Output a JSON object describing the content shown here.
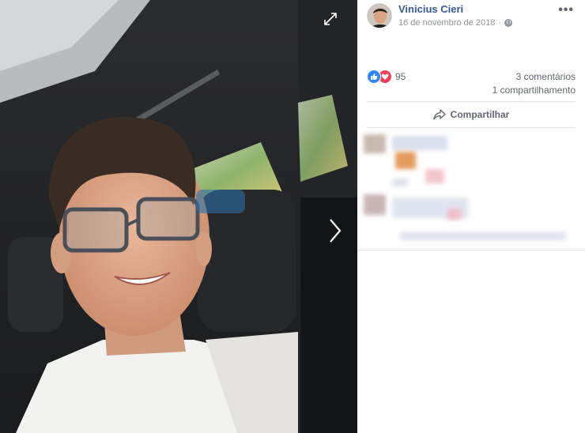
{
  "photo": {
    "expand_icon": "expand-icon",
    "next_icon": "chevron-right-icon"
  },
  "post": {
    "author": "Vinicius Cieri",
    "date": "16 de novembro de 2018",
    "privacy_icon": "globe-icon",
    "more_icon": "more-icon",
    "reaction_count": "95",
    "comments": "3 comentários",
    "shares": "1 compartilhamento",
    "share_label": "Compartilhar"
  },
  "colors": {
    "link": "#365899",
    "like": "#2d88ff",
    "love": "#f33e58",
    "muted": "#90949c"
  }
}
